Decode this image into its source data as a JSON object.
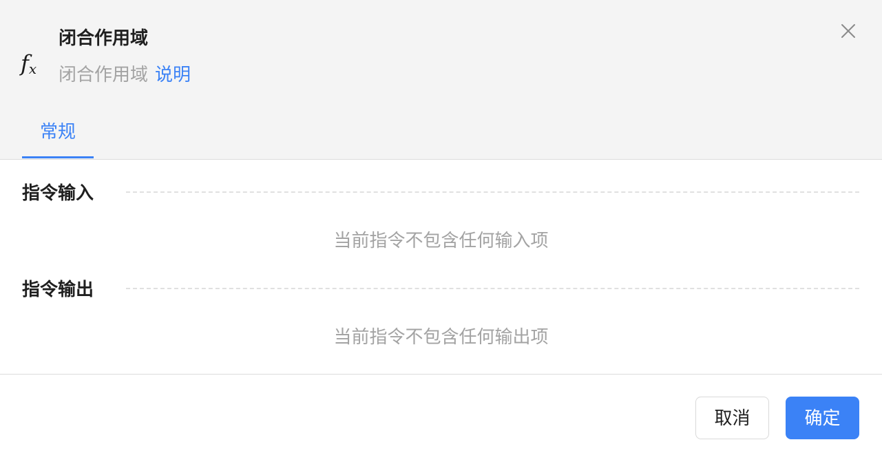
{
  "dialog": {
    "icon": "fx-function-icon",
    "fx_main": "f",
    "fx_sub": "x",
    "title": "闭合作用域",
    "subtitle": "闭合作用域",
    "help_link": "说明",
    "close_icon": "close-icon"
  },
  "tabs": [
    {
      "label": "常规",
      "active": true
    }
  ],
  "sections": {
    "input": {
      "title": "指令输入",
      "empty_text": "当前指令不包含任何输入项"
    },
    "output": {
      "title": "指令输出",
      "empty_text": "当前指令不包含任何输出项"
    }
  },
  "footer": {
    "cancel_label": "取消",
    "ok_label": "确定"
  },
  "colors": {
    "accent": "#3b82f6",
    "header_bg": "#f4f4f4",
    "muted_text": "#a3a3a3"
  }
}
